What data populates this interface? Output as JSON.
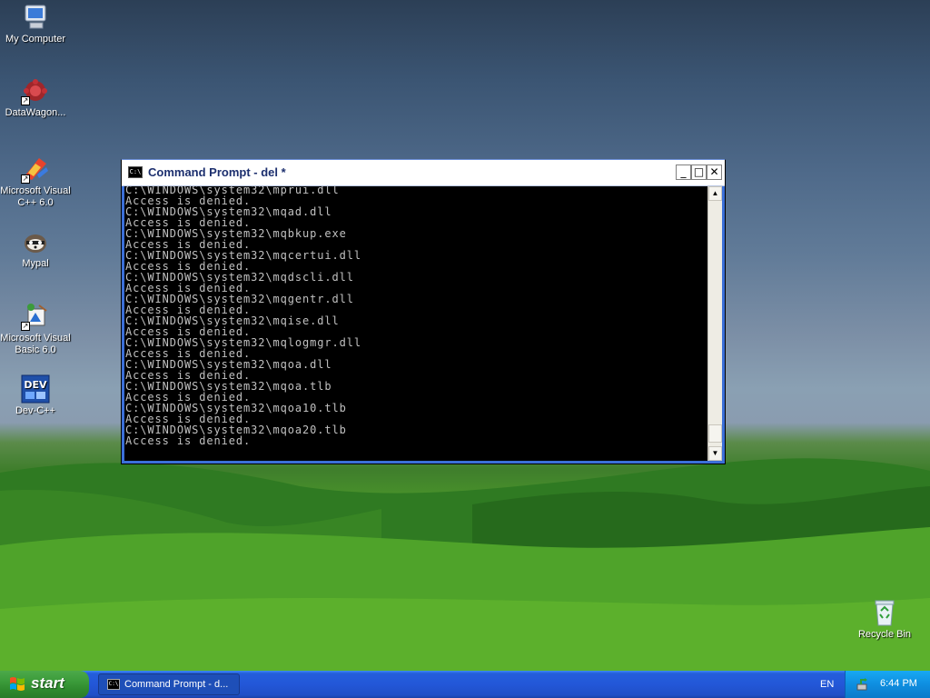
{
  "desktop": {
    "icons": [
      {
        "label": "My Computer",
        "icon": "computer-icon"
      },
      {
        "label": "DataWagon...",
        "icon": "datawagon-icon"
      },
      {
        "label": "Microsoft Visual C++ 6.0",
        "icon": "visual-cpp-icon"
      },
      {
        "label": "Mypal",
        "icon": "mypal-icon"
      },
      {
        "label": "Microsoft Visual Basic 6.0",
        "icon": "visual-basic-icon"
      },
      {
        "label": "Dev-C++",
        "icon": "dev-cpp-icon"
      },
      {
        "label": "Recycle Bin",
        "icon": "recycle-bin-icon"
      }
    ]
  },
  "window": {
    "title": "Command Prompt - del *",
    "icon_glyph": "C:\\",
    "minimize": "_",
    "maximize": "□",
    "close": "✕",
    "console_lines": [
      "C:\\WINDOWS\\system32\\mprui.dll",
      "Access is denied.",
      "C:\\WINDOWS\\system32\\mqad.dll",
      "Access is denied.",
      "C:\\WINDOWS\\system32\\mqbkup.exe",
      "Access is denied.",
      "C:\\WINDOWS\\system32\\mqcertui.dll",
      "Access is denied.",
      "C:\\WINDOWS\\system32\\mqdscli.dll",
      "Access is denied.",
      "C:\\WINDOWS\\system32\\mqgentr.dll",
      "Access is denied.",
      "C:\\WINDOWS\\system32\\mqise.dll",
      "Access is denied.",
      "C:\\WINDOWS\\system32\\mqlogmgr.dll",
      "Access is denied.",
      "C:\\WINDOWS\\system32\\mqoa.dll",
      "Access is denied.",
      "C:\\WINDOWS\\system32\\mqoa.tlb",
      "Access is denied.",
      "C:\\WINDOWS\\system32\\mqoa10.tlb",
      "Access is denied.",
      "C:\\WINDOWS\\system32\\mqoa20.tlb",
      "Access is denied."
    ],
    "scroll_up": "▲",
    "scroll_down": "▼"
  },
  "taskbar": {
    "start_label": "start",
    "tasks": [
      {
        "label": "Command Prompt - d...",
        "icon_glyph": "C:\\"
      }
    ],
    "language": "EN",
    "clock": "6:44 PM"
  }
}
